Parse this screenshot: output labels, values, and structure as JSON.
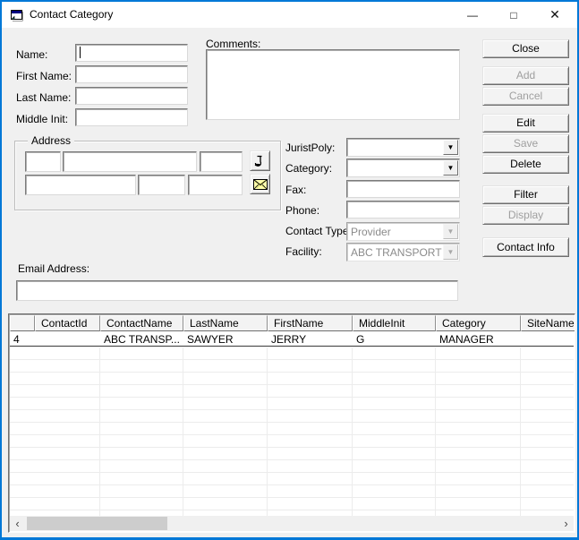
{
  "colors": {
    "accent_blue": "#0078d7",
    "window_bg": "#f0f0f0",
    "titlebar_bg": "#ffffff",
    "disabled_text": "#9f9f9f",
    "envelope_yellow": "#ffffb0",
    "grid_line": "#ececec",
    "scroll_thumb": "#cdcdcd"
  },
  "window": {
    "title": "Contact Category",
    "controls": {
      "minimize": "—",
      "maximize": "□",
      "close": "✕"
    }
  },
  "identity": {
    "name_label": "Name:",
    "name_value": "",
    "first_name_label": "First Name:",
    "first_name_value": "",
    "last_name_label": "Last Name:",
    "last_name_value": "",
    "middle_init_label": "Middle Init:",
    "middle_init_value": ""
  },
  "comments": {
    "label": "Comments:",
    "value": ""
  },
  "address": {
    "label": "Address",
    "line1_values": [
      "",
      "",
      ""
    ],
    "line2_values": [
      "",
      "",
      ""
    ]
  },
  "details": {
    "juristpoly": {
      "label": "JuristPoly:",
      "value": "",
      "enabled": true
    },
    "category": {
      "label": "Category:",
      "value": "",
      "enabled": true
    },
    "fax": {
      "label": "Fax:",
      "value": ""
    },
    "phone": {
      "label": "Phone:",
      "value": ""
    },
    "contact_type": {
      "label": "Contact Type:",
      "value": "Provider",
      "enabled": false
    },
    "facility": {
      "label": "Facility:",
      "value": "ABC TRANSPORT",
      "enabled": false
    }
  },
  "email": {
    "label": "Email Address:",
    "value": ""
  },
  "action_buttons": [
    {
      "label": "Close",
      "enabled": true
    },
    {
      "label": "Add",
      "enabled": false
    },
    {
      "label": "Cancel",
      "enabled": false
    },
    {
      "label": "Edit",
      "enabled": true
    },
    {
      "label": "Save",
      "enabled": false
    },
    {
      "label": "Delete",
      "enabled": true
    },
    {
      "label": "Filter",
      "enabled": true
    },
    {
      "label": "Display",
      "enabled": false
    },
    {
      "label": "Contact Info",
      "enabled": true
    }
  ],
  "grid": {
    "columns": [
      "ContactId",
      "ContactName",
      "LastName",
      "FirstName",
      "MiddleInit",
      "Category",
      "SiteName"
    ],
    "rows": [
      [
        "4",
        "ABC TRANSP...",
        "SAWYER",
        "JERRY",
        "G",
        "MANAGER",
        ""
      ]
    ]
  },
  "scrollbar": {
    "left_arrow": "‹",
    "right_arrow": "›"
  }
}
